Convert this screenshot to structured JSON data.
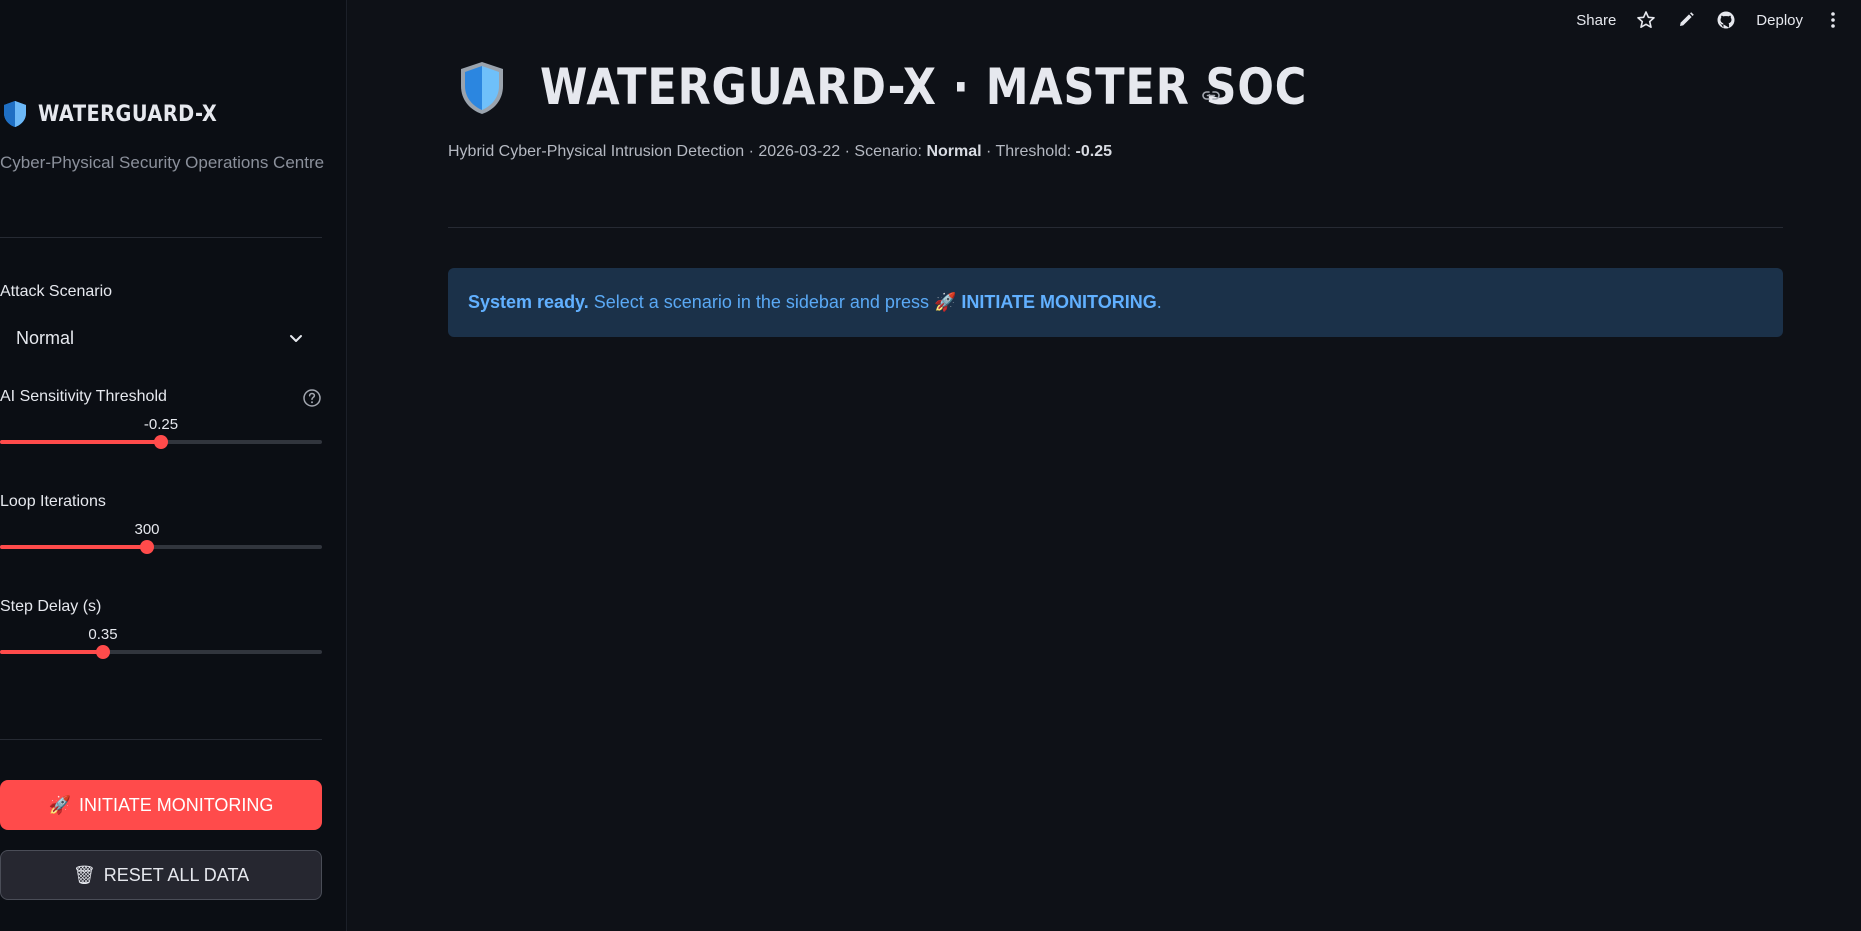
{
  "toolbar": {
    "share": "Share",
    "deploy": "Deploy",
    "icons": [
      "star-icon",
      "pencil-icon",
      "github-icon",
      "more-vertical-icon"
    ]
  },
  "sidebar": {
    "brand_title": "WATERGUARD-X",
    "brand_subtitle": "Cyber-Physical Security Operations Centre",
    "attack_scenario": {
      "label": "Attack Scenario",
      "selected": "Normal"
    },
    "threshold": {
      "label": "AI Sensitivity Threshold",
      "value": "-0.25",
      "fill_fraction": 0.5
    },
    "loop_iterations": {
      "label": "Loop Iterations",
      "value": "300",
      "fill_fraction": 0.455
    },
    "step_delay": {
      "label": "Step Delay (s)",
      "value": "0.35",
      "fill_fraction": 0.32
    },
    "initiate_button": {
      "glyph": "🚀",
      "label": "INITIATE MONITORING"
    },
    "reset_button": {
      "glyph": "🗑",
      "label": "RESET ALL DATA"
    }
  },
  "main": {
    "title": "WATERGUARD-X · MASTER SOC",
    "caption": {
      "prefix": "Hybrid Cyber-Physical Intrusion Detection · 2026-03-22 · Scenario: ",
      "scenario": "Normal",
      "middle": " · Threshold: ",
      "threshold": "-0.25"
    },
    "alert": {
      "strong": "System ready.",
      "text": " Select a scenario in the sidebar and press 🚀 ",
      "action": "INITIATE MONITORING",
      "suffix": "."
    }
  },
  "colors": {
    "accent": "#ff4b4b",
    "info_bg": "#1b3149",
    "info_text": "#5aa9f5",
    "shield": "#4aa3f0"
  }
}
